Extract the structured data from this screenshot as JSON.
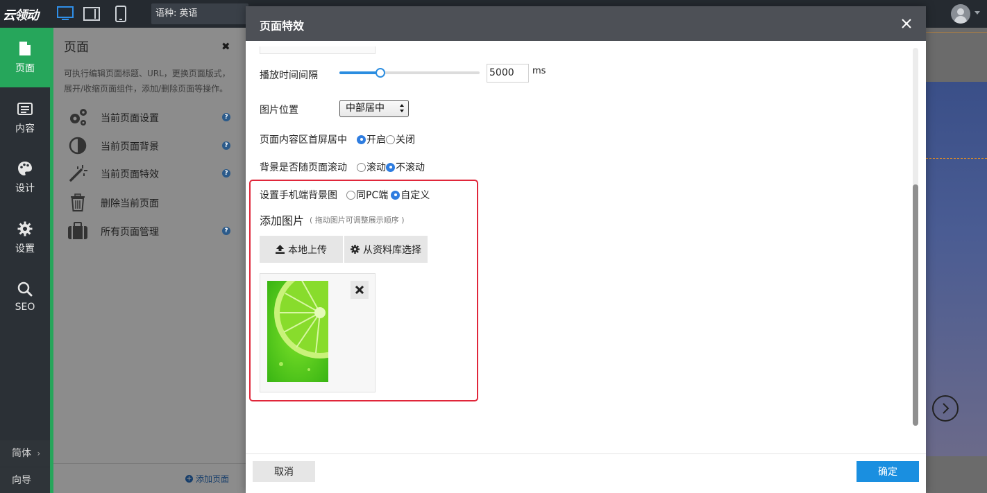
{
  "topbar": {
    "logo": "云领动",
    "language_label": "语种: 英语"
  },
  "leftnav": {
    "items": [
      {
        "label": "页面",
        "icon": "page-icon",
        "active": true
      },
      {
        "label": "内容",
        "icon": "content-list-icon",
        "active": false
      },
      {
        "label": "设计",
        "icon": "palette-icon",
        "active": false
      },
      {
        "label": "设置",
        "icon": "gear-icon",
        "active": false
      },
      {
        "label": "SEO",
        "icon": "search-icon",
        "active": false
      }
    ],
    "bottom": [
      {
        "label": "简体",
        "icon": "chevron-right-icon"
      },
      {
        "label": "向导"
      }
    ]
  },
  "panel": {
    "title": "页面",
    "description": "可执行编辑页面标题、URL，更换页面版式，展开/收缩页面组件，添加/删除页面等操作。",
    "menu": [
      {
        "label": "当前页面设置",
        "icon": "gears-icon",
        "help": true
      },
      {
        "label": "当前页面背景",
        "icon": "contrast-icon",
        "help": true
      },
      {
        "label": "当前页面特效",
        "icon": "magic-wand-icon",
        "help": true
      },
      {
        "label": "删除当前页面",
        "icon": "trash-icon",
        "help": false
      },
      {
        "label": "所有页面管理",
        "icon": "briefcase-icon",
        "help": true
      }
    ],
    "help_glyph": "?",
    "add_page_label": "添加页面"
  },
  "modal": {
    "title": "页面特效",
    "interval": {
      "label": "播放时间间隔",
      "value": "5000",
      "unit": "ms",
      "slider_fraction": 0.29
    },
    "image_position": {
      "label": "图片位置",
      "selected": "中部居中"
    },
    "center_content": {
      "label": "页面内容区首屏居中",
      "options": [
        "开启",
        "关闭"
      ],
      "selected": 0
    },
    "scroll_bg": {
      "label": "背景是否随页面滚动",
      "options": [
        "滚动",
        "不滚动"
      ],
      "selected": 1
    },
    "mobile_bg": {
      "label": "设置手机端背景图",
      "options": [
        "同PC端",
        "自定义"
      ],
      "selected": 1
    },
    "add_image": {
      "title": "添加图片",
      "hint": "( 拖动图片可调整展示顺序 )"
    },
    "buttons": {
      "upload": "本地上传",
      "library": "从资料库选择"
    },
    "footer": {
      "cancel": "取消",
      "ok": "确定"
    }
  },
  "colors": {
    "accent_green": "#26a65b",
    "primary_blue": "#1a8fe0",
    "highlight_red": "#e0263a"
  }
}
